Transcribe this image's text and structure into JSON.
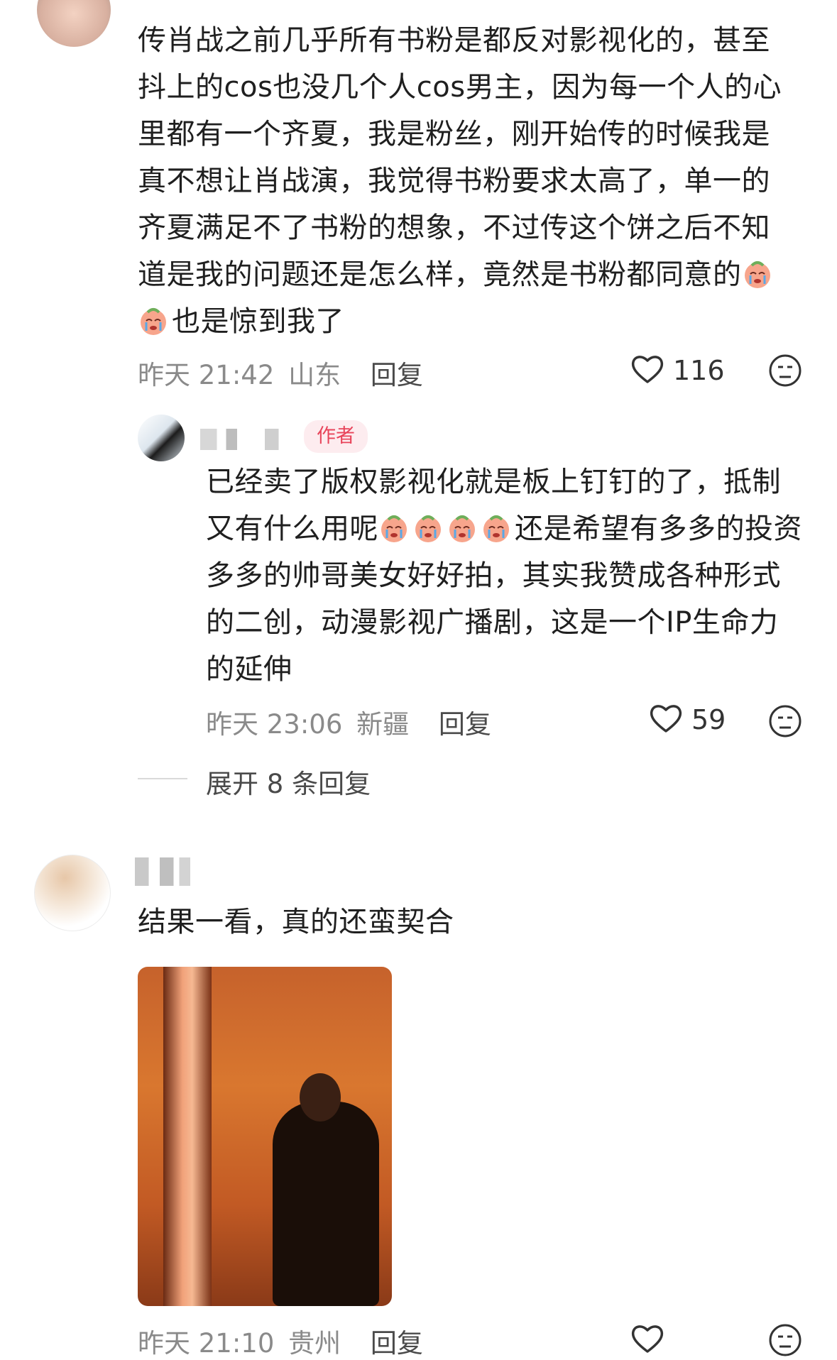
{
  "comment1": {
    "text": "传肖战之前几乎所有书粉是都反对影视化的，甚至抖上的cos也没几个人cos男主，因为每一个人的心里都有一个齐夏，我是粉丝，刚开始传的时候我是真不想让肖战演，我觉得书粉要求太高了，单一的齐夏满足不了书粉的想象，不过传这个饼之后不知道是我的问题还是怎么样，竟然是书粉都同意的",
    "text_tail": "也是惊到我了",
    "time": "昨天 21:42",
    "location": "山东",
    "reply_label": "回复",
    "likes": "116"
  },
  "reply1": {
    "author_badge": "作者",
    "text_a": "已经卖了版权影视化就是板上钉钉的了，抵制又有什么用呢",
    "text_b": "还是希望有多多的投资多多的帅哥美女好好拍，其实我赞成各种形式的二创，动漫影视广播剧，这是一个IP生命力的延伸",
    "time": "昨天 23:06",
    "location": "新疆",
    "reply_label": "回复",
    "likes": "59"
  },
  "expand_label": "展开 8 条回复",
  "comment2": {
    "text": "结果一看，真的还蛮契合",
    "time": "昨天 21:10",
    "location": "贵州",
    "reply_label": "回复"
  },
  "icons": [
    "heart-icon",
    "emoji-face-icon",
    "crying-emoji-icon"
  ]
}
